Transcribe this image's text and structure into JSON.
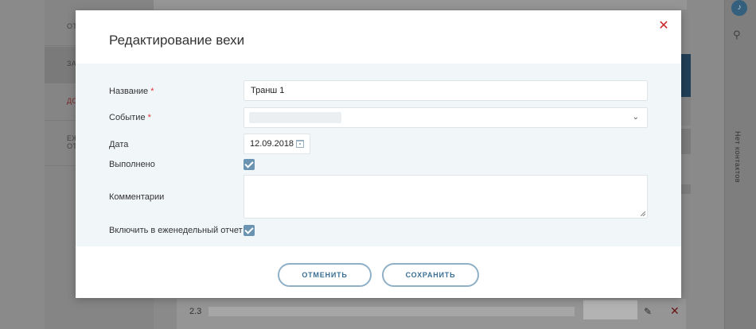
{
  "background": {
    "left_items": [
      {
        "label": "ОТ"
      },
      {
        "label": "ЗА"
      },
      {
        "label": "ДО"
      },
      {
        "label": "ЕЖ",
        "label2": "ОТ"
      }
    ],
    "row_number": "2.3",
    "contacts_text": "Нет контактов",
    "icons": {
      "bell": "bell-icon",
      "search": "search-icon",
      "edit": "edit-icon",
      "delete": "delete-icon"
    }
  },
  "modal": {
    "title": "Редактирование вехи",
    "close_icon": "close-icon",
    "fields": {
      "name": {
        "label": "Название",
        "required_mark": "*",
        "value": "Транш 1"
      },
      "event": {
        "label": "Событие",
        "required_mark": "*",
        "value": ""
      },
      "date": {
        "label": "Дата",
        "value": "12.09.2018"
      },
      "done": {
        "label": "Выполнено",
        "checked": true
      },
      "comments": {
        "label": "Комментарии",
        "value": ""
      },
      "weekly": {
        "label": "Включить в еженедельный отчет",
        "checked": true
      }
    },
    "buttons": {
      "cancel": "ОТМЕНИТЬ",
      "save": "СОХРАНИТЬ"
    }
  },
  "colors": {
    "accent": "#6b94b3",
    "close": "#c82828",
    "required": "#dd3333",
    "button_text": "#3b6f93"
  }
}
